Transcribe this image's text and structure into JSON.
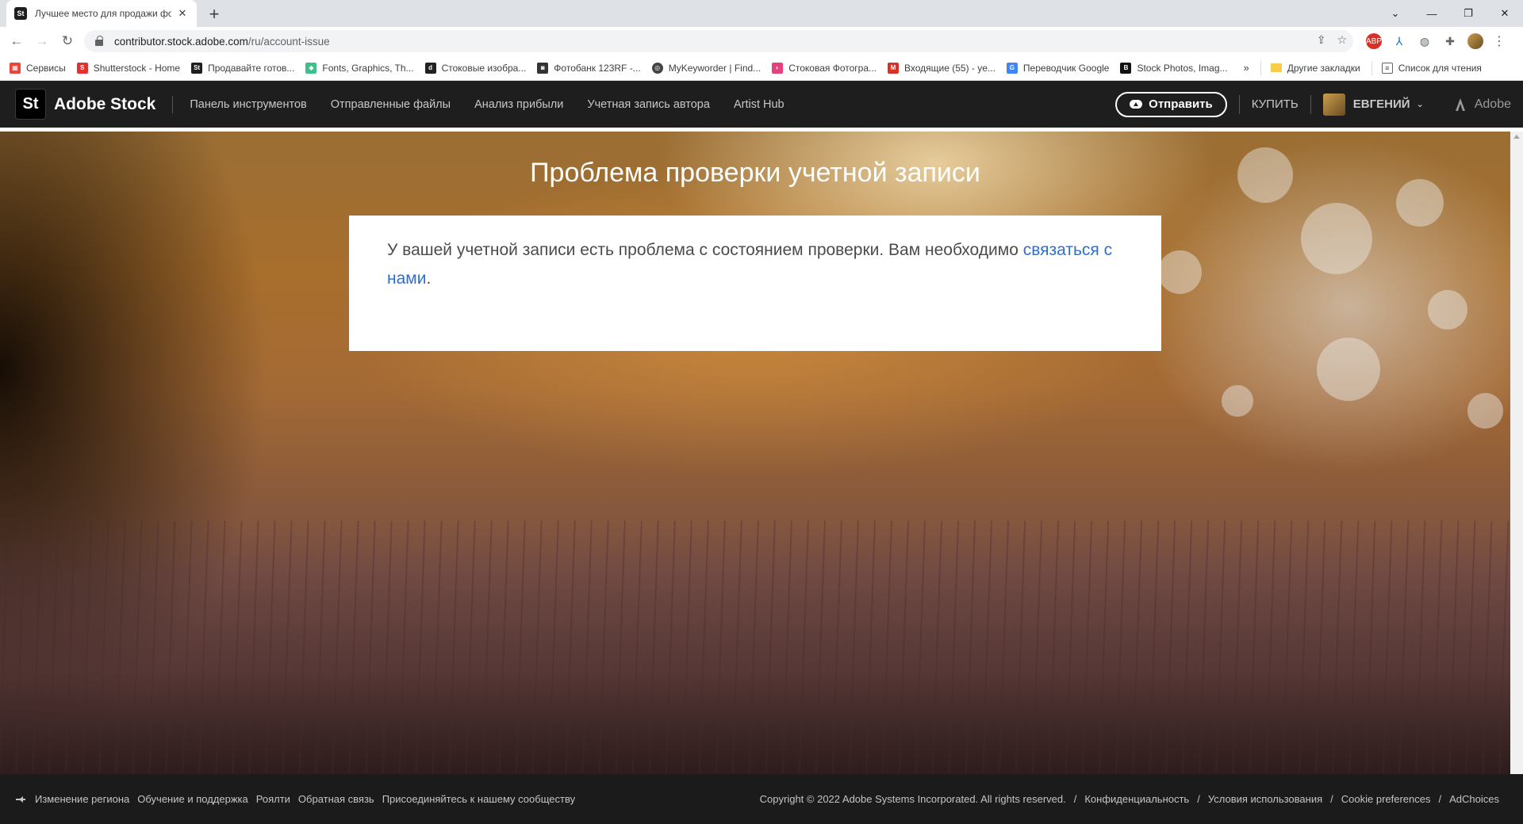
{
  "browser": {
    "tab_title": "Лучшее место для продажи фото",
    "tab_favicon": "St",
    "url_host": "contributor.stock.adobe.com",
    "url_path": "/ru/account-issue",
    "window_controls": [
      "chevron-down-icon",
      "minimize-icon",
      "restore-icon",
      "close-icon"
    ]
  },
  "bookmarks": {
    "items": [
      {
        "label": "Сервисы",
        "icon": "apps-grid-icon",
        "color": "#e8453c"
      },
      {
        "label": "Shutterstock - Home",
        "icon": "shutterstock-icon",
        "color": "#e3312d"
      },
      {
        "label": "Продавайте готов...",
        "icon": "adobe-stock-icon",
        "color": "#1f1f1f"
      },
      {
        "label": "Fonts, Graphics, Th...",
        "icon": "creative-market-icon",
        "color": "#3fbf8a"
      },
      {
        "label": "Стоковые изобра...",
        "icon": "depositphotos-icon",
        "color": "#222222"
      },
      {
        "label": "Фотобанк 123RF -...",
        "icon": "camera-icon",
        "color": "#333333"
      },
      {
        "label": "MyKeyworder | Find...",
        "icon": "keyworder-icon",
        "color": "#444444"
      },
      {
        "label": "Стоковая Фотогра...",
        "icon": "dreamstime-icon",
        "color": "#e4407b"
      },
      {
        "label": "Входящие (55) - ye...",
        "icon": "gmail-icon",
        "color": "#d93025"
      },
      {
        "label": "Переводчик Google",
        "icon": "google-translate-icon",
        "color": "#4285f4"
      },
      {
        "label": "Stock Photos, Imag...",
        "icon": "bigstock-icon",
        "color": "#111111"
      }
    ],
    "more": "»",
    "other_folder": "Другие закладки",
    "reading_list": "Список для чтения"
  },
  "header": {
    "logo_mark": "St",
    "logo_text": "Adobe Stock",
    "nav": [
      "Панель инструментов",
      "Отправленные файлы",
      "Анализ прибыли",
      "Учетная запись автора",
      "Artist Hub"
    ],
    "upload_label": "Отправить",
    "buy_label": "КУПИТЬ",
    "user_name": "ЕВГЕНИЙ",
    "adobe_label": "Adobe"
  },
  "main": {
    "title": "Проблема проверки учетной записи",
    "message": "У вашей учетной записи есть проблема с состоянием проверки. Вам необходимо ",
    "link_text": "связаться с нами",
    "message_end": "."
  },
  "footer": {
    "left": [
      "Изменение региона",
      "Обучение и поддержка",
      "Роялти",
      "Обратная связь",
      "Присоединяйтесь к нашему сообществу"
    ],
    "copyright": "Copyright © 2022 Adobe Systems Incorporated. All rights reserved.",
    "right": [
      "Конфиденциальность",
      "Условия использования",
      "Cookie preferences",
      "AdChoices"
    ],
    "separator": "/"
  },
  "colors": {
    "header_bg": "#1e1e1e",
    "link": "#2c6fd1",
    "footer_bg": "#1b1b1b"
  }
}
